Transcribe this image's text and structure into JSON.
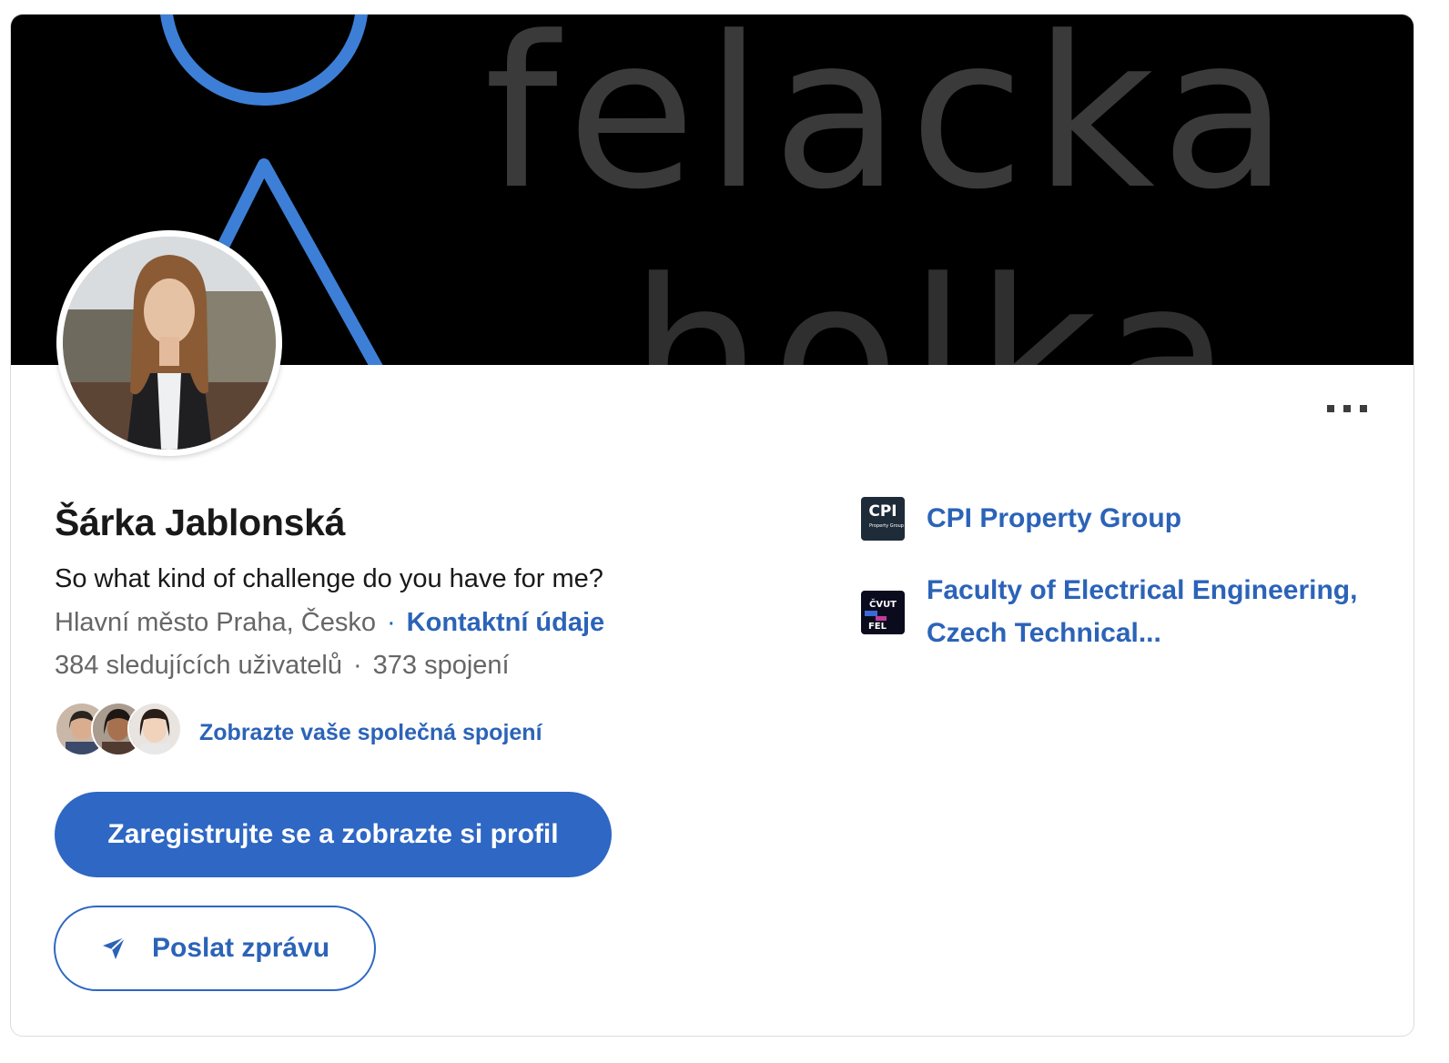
{
  "profile": {
    "name": "Šárka Jablonská",
    "headline": "So what kind of challenge do you have for me?",
    "location": "Hlavní město Praha, Česko",
    "location_separator": "·",
    "contact_label": "Kontaktní údaje",
    "followers": "384 sledujících uživatelů",
    "stats_separator": "·",
    "connections": "373 spojení",
    "mutual_label": "Zobrazte vaše společná spojení"
  },
  "cover": {
    "text_line1": "felacka",
    "text_line2": "holka"
  },
  "actions": {
    "register_label": "Zaregistrujte se a zobrazte si profil",
    "message_label": "Poslat zprávu"
  },
  "experience": [
    {
      "name": "CPI Property Group",
      "logo_text": "CPI",
      "logo_subtext": "Property Group"
    },
    {
      "name": "Faculty of Electrical Engineering, Czech Technical...",
      "logo_text_top": "ČVUT",
      "logo_text_bottom": "FEL"
    }
  ],
  "colors": {
    "brand_blue": "#2e67c4",
    "link_blue": "#2b63b8",
    "cover_accent": "#3d7fd6"
  },
  "icons": {
    "more": "more-horizontal-icon",
    "send": "paper-plane-icon"
  }
}
